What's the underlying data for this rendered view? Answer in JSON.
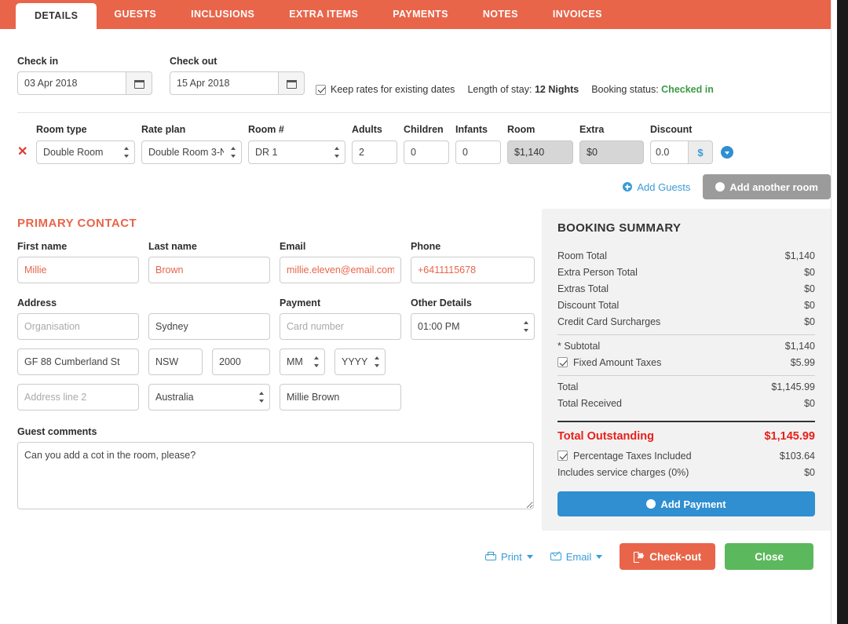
{
  "theme": {
    "accent": "#e8654a",
    "link_blue": "#3a9cd6",
    "green": "#5cb85c",
    "status_green": "#3c9a46",
    "danger_red": "#e8201b",
    "summary_bg": "#f2f2f2"
  },
  "tabs": [
    {
      "label": "DETAILS",
      "active": true
    },
    {
      "label": "GUESTS",
      "active": false
    },
    {
      "label": "INCLUSIONS",
      "active": false
    },
    {
      "label": "EXTRA ITEMS",
      "active": false
    },
    {
      "label": "PAYMENTS",
      "active": false
    },
    {
      "label": "NOTES",
      "active": false
    },
    {
      "label": "INVOICES",
      "active": false
    }
  ],
  "dates": {
    "checkin_label": "Check in",
    "checkin_value": "03 Apr 2018",
    "checkout_label": "Check out",
    "checkout_value": "15 Apr 2018",
    "keep_rates_label": "Keep rates for existing dates",
    "keep_rates_checked": true,
    "length_of_stay_label": "Length of stay:",
    "length_of_stay_value": "12 Nights",
    "booking_status_label": "Booking status:",
    "booking_status_value": "Checked in"
  },
  "room_row": {
    "headers": {
      "room_type": "Room type",
      "rate_plan": "Rate plan",
      "room_number": "Room #",
      "adults": "Adults",
      "children": "Children",
      "infants": "Infants",
      "room": "Room",
      "extra": "Extra",
      "discount": "Discount"
    },
    "values": {
      "room_type": "Double Room",
      "rate_plan": "Double Room 3-N",
      "room_number": "DR 1",
      "adults": "2",
      "children": "0",
      "infants": "0",
      "room": "$1,140",
      "extra": "$0",
      "discount": "0.0",
      "discount_unit": "$"
    },
    "add_guests_label": "Add Guests",
    "add_room_label": "Add another room"
  },
  "primary_contact": {
    "section_title": "PRIMARY CONTACT",
    "first_name_label": "First name",
    "first_name_value": "Millie",
    "last_name_label": "Last name",
    "last_name_value": "Brown",
    "email_label": "Email",
    "email_value": "millie.eleven@email.com",
    "phone_label": "Phone",
    "phone_value": "+6411115678"
  },
  "address": {
    "address_label": "Address",
    "payment_label": "Payment",
    "other_details_label": "Other Details",
    "organisation_placeholder": "Organisation",
    "organisation_value": "",
    "city_value": "Sydney",
    "street_value": "GF 88 Cumberland St",
    "state_value": "NSW",
    "postcode_value": "2000",
    "address2_placeholder": "Address line 2",
    "address2_value": "",
    "country_value": "Australia",
    "card_number_placeholder": "Card number",
    "card_number_value": "",
    "expiry_month": "MM",
    "expiry_year": "YYYY",
    "card_name_value": "Millie Brown",
    "arrival_time_value": "01:00 PM"
  },
  "comments": {
    "label": "Guest comments",
    "value": "Can you add a cot in the room, please?"
  },
  "summary": {
    "title": "BOOKING SUMMARY",
    "lines": [
      {
        "label": "Room Total",
        "value": "$1,140"
      },
      {
        "label": "Extra Person Total",
        "value": "$0"
      },
      {
        "label": "Extras Total",
        "value": "$0"
      },
      {
        "label": "Discount Total",
        "value": "$0"
      },
      {
        "label": "Credit Card Surcharges",
        "value": "$0"
      }
    ],
    "subtotal_label": "* Subtotal",
    "subtotal_value": "$1,140",
    "fixed_taxes_label": "Fixed Amount Taxes",
    "fixed_taxes_value": "$5.99",
    "fixed_taxes_checked": true,
    "total_label": "Total",
    "total_value": "$1,145.99",
    "total_received_label": "Total Received",
    "total_received_value": "$0",
    "outstanding_label": "Total Outstanding",
    "outstanding_value": "$1,145.99",
    "pct_taxes_label": "Percentage Taxes Included",
    "pct_taxes_value": "$103.64",
    "pct_taxes_checked": true,
    "service_charges_label": "Includes service charges (0%)",
    "service_charges_value": "$0",
    "add_payment_label": "Add Payment"
  },
  "footer": {
    "print_label": "Print",
    "email_label": "Email",
    "checkout_label": "Check-out",
    "close_label": "Close"
  }
}
